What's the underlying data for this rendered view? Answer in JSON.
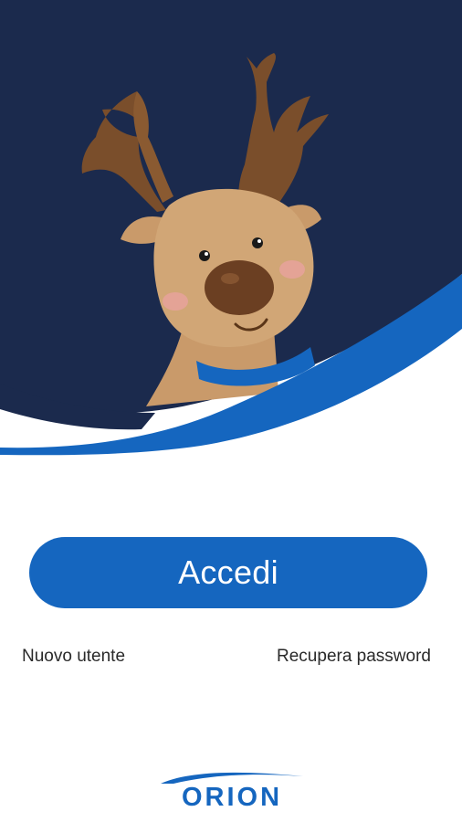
{
  "app": {
    "colors": {
      "header_navy": "#1b2a4d",
      "accent_blue": "#1566bf",
      "deer_body": "#c99a6a",
      "antler_brown": "#7a4e2b",
      "nose_brown": "#6b3f22"
    }
  },
  "hero": {
    "mascot": "reindeer-mascot",
    "mascot_icon": "reindeer-icon"
  },
  "actions": {
    "login_label": "Accedi",
    "new_user_label": "Nuovo utente",
    "recover_password_label": "Recupera password"
  },
  "brand": {
    "name": "ORION",
    "logo_icon": "orion-logo"
  }
}
